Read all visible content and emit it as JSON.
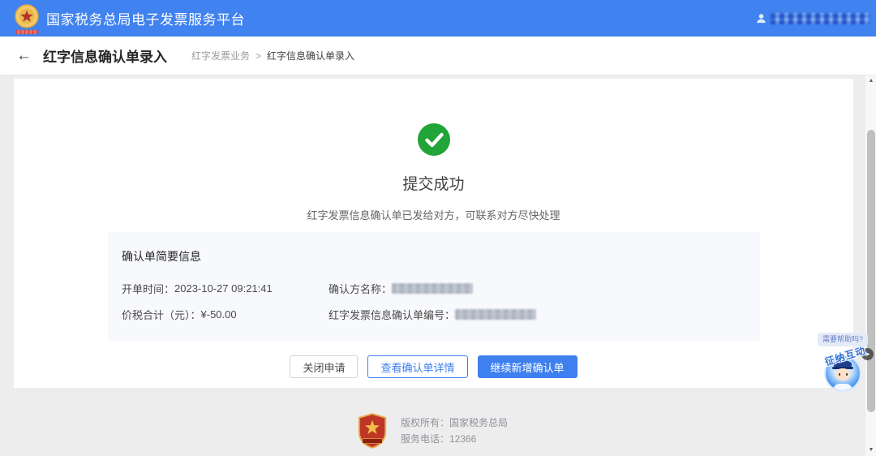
{
  "app": {
    "header_title": "国家税务总局电子发票服务平台"
  },
  "nav": {
    "back_icon": "←",
    "page_title": "红字信息确认单录入",
    "breadcrumb_parent": "红字发票业务",
    "breadcrumb_sep": ">",
    "breadcrumb_current": "红字信息确认单录入"
  },
  "result": {
    "status_icon": "check-circle",
    "title": "提交成功",
    "subtitle": "红字发票信息确认单已发给对方，可联系对方尽快处理"
  },
  "summary": {
    "title": "确认单简要信息",
    "issue_time_label": "开单时间： ",
    "issue_time_value": "2023-10-27 09:21:41",
    "total_label": "价税合计（元）： ",
    "total_value": "¥-50.00",
    "confirm_party_label": "确认方名称：",
    "confirm_no_label": "红字发票信息确认单编号："
  },
  "actions": {
    "close_label": "关闭申请",
    "view_label": "查看确认单详情",
    "new_label": "继续新增确认单"
  },
  "footer": {
    "copyright": "版权所有：国家税务总局",
    "phone": "服务电话：12366"
  },
  "helper": {
    "bubble_text": "需要帮助吗?",
    "avatar_text": "征纳互动"
  },
  "scrollbar": {
    "up_glyph": "▲",
    "down_glyph": "▼"
  },
  "colors": {
    "header_blue": "#4082EF",
    "primary_blue": "#3F80F0",
    "success_green": "#21A438",
    "card_bg": "#F8F9FC",
    "page_bg": "#EDEDEE"
  }
}
